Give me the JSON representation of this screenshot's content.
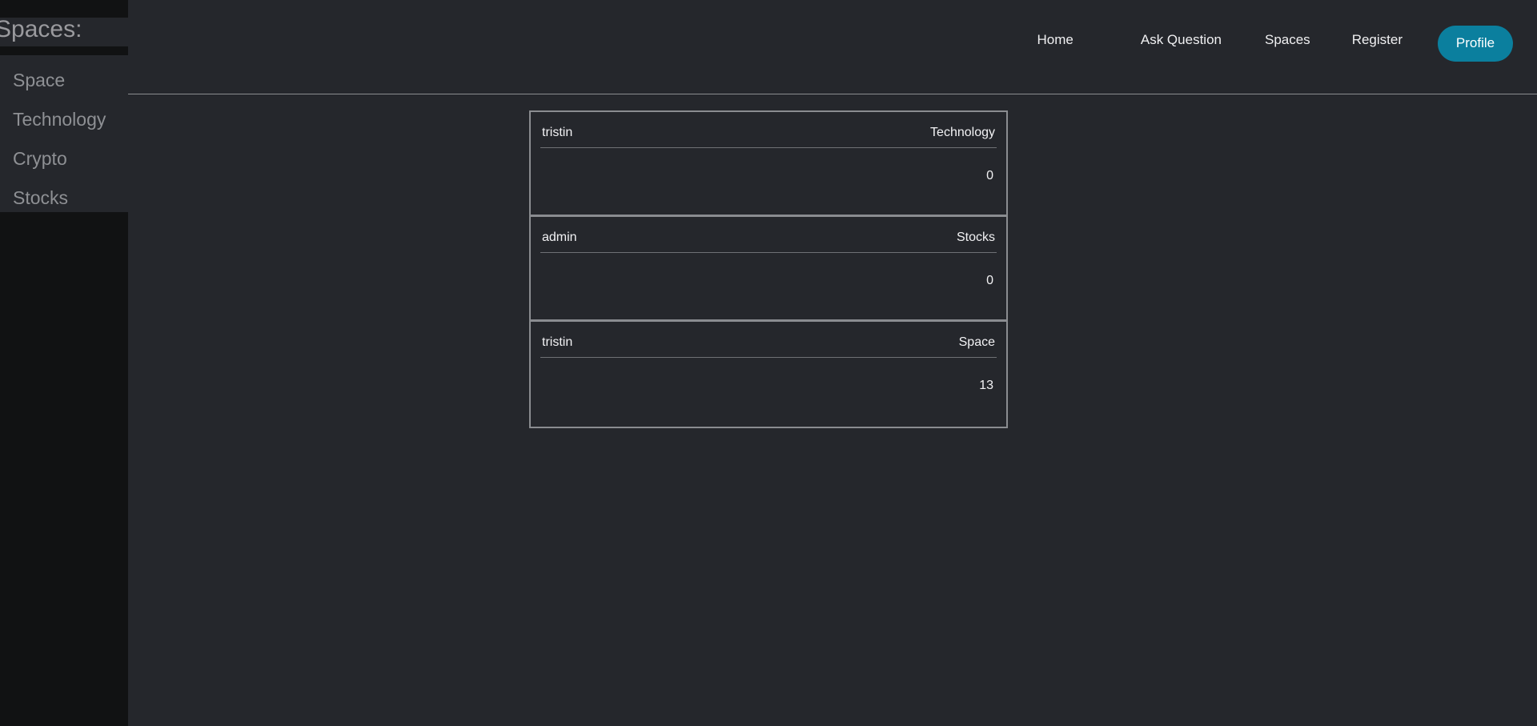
{
  "colors": {
    "background": "#25272c",
    "sidebar_dark": "#111213",
    "accent": "#0b7f9e",
    "border": "#8a8c90",
    "muted_text": "#8e9094",
    "text": "#f2f2f4"
  },
  "sidebar": {
    "heading": "Spaces:",
    "items": [
      {
        "label": "Space"
      },
      {
        "label": "Technology"
      },
      {
        "label": "Crypto"
      },
      {
        "label": "Stocks"
      }
    ]
  },
  "nav": {
    "links": [
      {
        "label": "Home"
      },
      {
        "label": "Ask Question"
      },
      {
        "label": "Spaces"
      },
      {
        "label": "Register"
      }
    ],
    "profile_label": "Profile"
  },
  "main": {
    "cards": [
      {
        "author": "tristin",
        "space": "Technology",
        "count": "0"
      },
      {
        "author": "admin",
        "space": "Stocks",
        "count": "0"
      },
      {
        "author": "tristin",
        "space": "Space",
        "count": "13"
      }
    ]
  }
}
